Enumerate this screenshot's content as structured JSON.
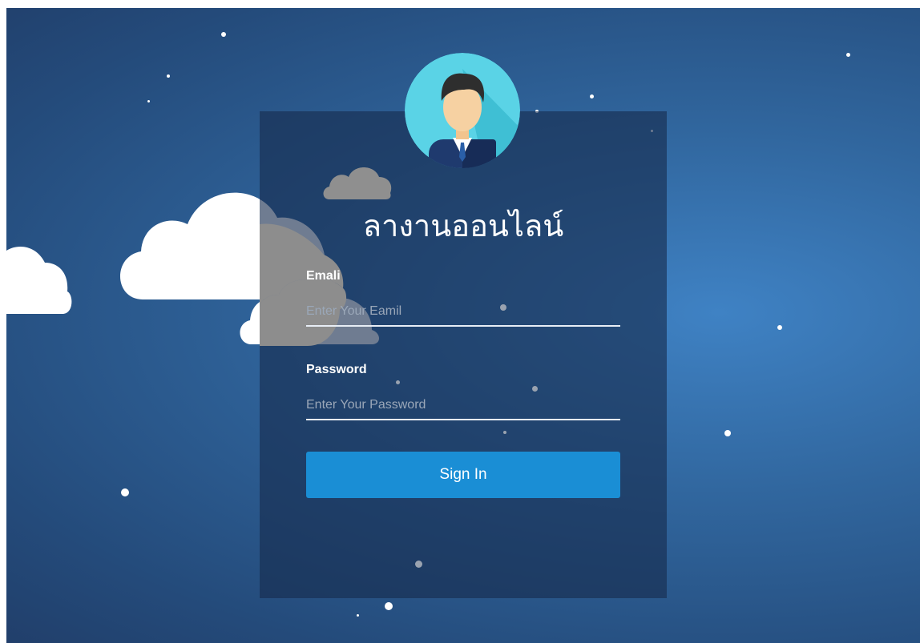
{
  "login": {
    "title": "ลางานออนไลน์",
    "email_label": "Emali",
    "email_placeholder": "Enter Your Eamil",
    "password_label": "Password",
    "password_placeholder": "Enter Your Password",
    "signin_label": "Sign In"
  },
  "icons": {
    "avatar": "user-avatar-icon",
    "clouds": "cloud-icon",
    "stars": "snow-dot"
  },
  "colors": {
    "background": "#2c5c92",
    "card": "#1c3661",
    "button": "#1a8ed5",
    "avatar_circle": "#5ad3e6",
    "text": "#ffffff"
  }
}
